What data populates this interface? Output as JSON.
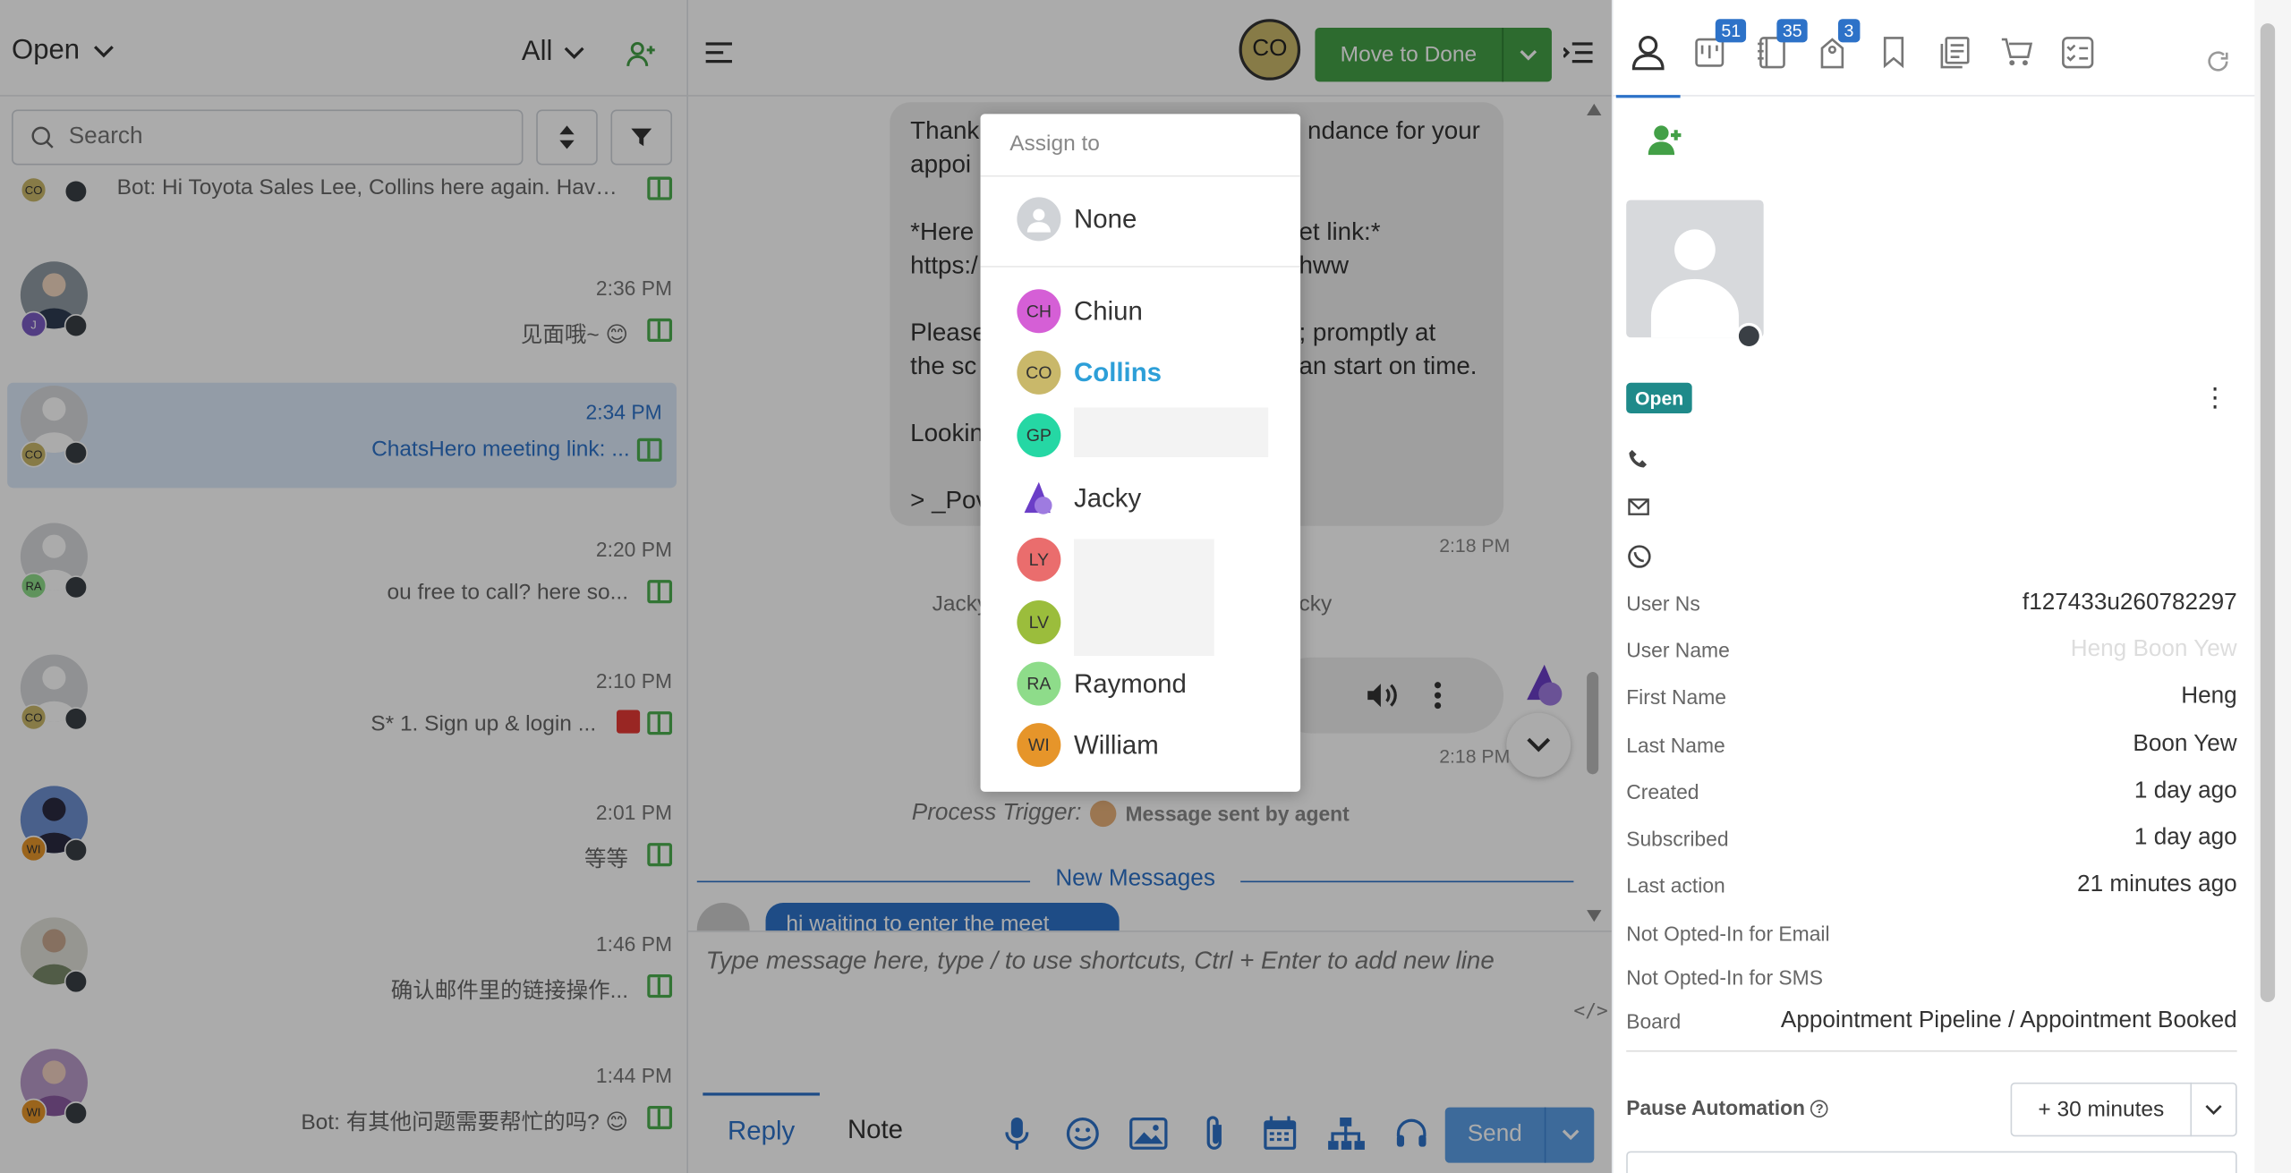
{
  "left": {
    "status_label": "Open",
    "filter_label": "All",
    "search_placeholder": "Search",
    "conversations": [
      {
        "preview": "Bot: Hi Toyota Sales Lee, Collins here again. Haven't...",
        "time": "",
        "badge": "CO",
        "badge_color": "#c9b86a"
      },
      {
        "preview": "见面哦~ 😊",
        "time": "2:36 PM",
        "badge": "",
        "badge_color": "#7b5cc4"
      },
      {
        "preview": "ChatsHero meeting link: ...",
        "time": "2:34 PM",
        "badge": "CO",
        "badge_color": "#c9b86a"
      },
      {
        "preview": "ou free to call? here so...",
        "time": "2:20 PM",
        "badge": "RA",
        "badge_color": "#8edc8a"
      },
      {
        "preview": "S* 1. Sign up & login ...",
        "time": "2:10 PM",
        "badge": "CO",
        "badge_color": "#c9b86a"
      },
      {
        "preview": "等等",
        "time": "2:01 PM",
        "badge": "WI",
        "badge_color": "#e6952a"
      },
      {
        "preview": "确认邮件里的链接操作...",
        "time": "1:46 PM",
        "badge": "",
        "badge_color": "#999999"
      },
      {
        "preview": "Bot: 有其他问题需要帮忙的吗? 😊",
        "time": "1:44 PM",
        "badge": "WI",
        "badge_color": "#e6952a"
      }
    ]
  },
  "mid": {
    "agent_initials": "CO",
    "done_label": "Move to Done",
    "bubble_lines": [
      "Thank",
      "ndance for your",
      "appoi",
      "*Here",
      "et link:*",
      "https:/",
      "hww",
      "Please",
      "; promptly at",
      "the sc",
      "an start on time.",
      "Lookin",
      "> _Pov"
    ],
    "time_1": "2:18 PM",
    "time_2": "2:18 PM",
    "jacky_left": "Jacky",
    "jacky_right": "cky",
    "process_label": "Process Trigger:",
    "process_sub": "Message sent by agent",
    "new_messages": "New Messages",
    "outgoing_preview": "hi waiting to enter the meet",
    "input_placeholder": "Type message here, type / to use shortcuts, Ctrl + Enter to add new line",
    "code_toggle": "</>",
    "tab_reply": "Reply",
    "tab_note": "Note",
    "send_label": "Send"
  },
  "assign": {
    "header": "Assign to",
    "items": [
      {
        "initials": "",
        "name": "None",
        "color": "#d0d3d7"
      },
      {
        "initials": "CH",
        "name": "Chiun",
        "color": "#d55fd6"
      },
      {
        "initials": "CO",
        "name": "Collins",
        "color": "#c9b86a"
      },
      {
        "initials": "GP",
        "name": "",
        "color": "#25d7a4"
      },
      {
        "initials": "",
        "name": "Jacky",
        "color": "#6b3ec7"
      },
      {
        "initials": "LY",
        "name": "",
        "color": "#ea6d6d"
      },
      {
        "initials": "LV",
        "name": "",
        "color": "#9bbd3c"
      },
      {
        "initials": "RA",
        "name": "Raymond",
        "color": "#8edc8a"
      },
      {
        "initials": "WI",
        "name": "William",
        "color": "#e6952a"
      }
    ]
  },
  "right": {
    "badges": [
      "51",
      "35",
      "3"
    ],
    "status": "Open",
    "fields": [
      {
        "label": "User Ns",
        "value": "f127433u260782297"
      },
      {
        "label": "User Name",
        "value": "Heng Boon Yew"
      },
      {
        "label": "First Name",
        "value": "Heng"
      },
      {
        "label": "Last Name",
        "value": "Boon Yew"
      },
      {
        "label": "Created",
        "value": "1 day ago"
      },
      {
        "label": "Subscribed",
        "value": "1 day ago"
      },
      {
        "label": "Last action",
        "value": "21 minutes ago"
      },
      {
        "label": "Not Opted-In for Email",
        "value": ""
      },
      {
        "label": "Not Opted-In for SMS",
        "value": ""
      },
      {
        "label": "Board",
        "value": "Appointment Pipeline / Appointment Booked"
      }
    ],
    "pause_label": "Pause Automation",
    "pause_value": "+ 30 minutes",
    "accent": "#2d72c8"
  }
}
